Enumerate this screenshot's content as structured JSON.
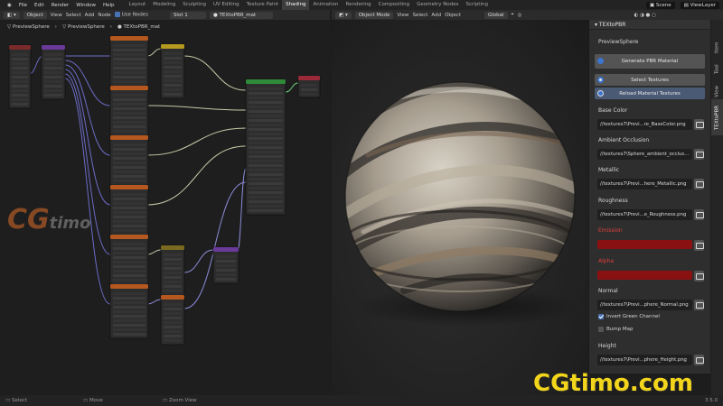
{
  "menubar": {
    "items": [
      "File",
      "Edit",
      "Render",
      "Window",
      "Help"
    ],
    "workspaces": [
      "Layout",
      "Modeling",
      "Sculpting",
      "UV Editing",
      "Texture Paint",
      "Shading",
      "Animation",
      "Rendering",
      "Compositing",
      "Geometry Nodes",
      "Scripting"
    ],
    "active_workspace": "Shading",
    "scene": "Scene",
    "view_layer": "ViewLayer"
  },
  "node_header": {
    "editor_type": "Object",
    "menus": [
      "View",
      "Select",
      "Add",
      "Node"
    ],
    "use_nodes_label": "Use Nodes",
    "slot": "Slot 1",
    "material": "TEXtoPBR_mat"
  },
  "breadcrumb": [
    "PreviewSphere",
    "PreviewSphere",
    "TEXtoPBR_mat"
  ],
  "viewport_header": {
    "mode": "Object Mode",
    "menus": [
      "View",
      "Select",
      "Add",
      "Object"
    ],
    "transform": "Global"
  },
  "panel": {
    "title": "TEXtoPBR",
    "object_name": "PreviewSphere",
    "generate_label": "Generate PBR Material",
    "select_label": "Select Textures",
    "reload_label": "Reload Material Textures",
    "base_color": {
      "label": "Base Color",
      "path": "//textures7\\Previ...re_BaseColor.png"
    },
    "ao": {
      "label": "Ambient Occlusion",
      "path": "//textures7\\Sphere_ambient_occlus..."
    },
    "metallic": {
      "label": "Metallic",
      "path": "//textures7\\Previ...here_Metallic.png"
    },
    "roughness": {
      "label": "Roughness",
      "path": "//textures7\\Previ...e_Roughness.png"
    },
    "emission": {
      "label": "Emission"
    },
    "alpha": {
      "label": "Alpha"
    },
    "normal": {
      "label": "Normal",
      "path": "//textures7\\Previ...phere_Normal.png"
    },
    "invert_green": {
      "label": "Invert Green Channel",
      "checked": true
    },
    "bump_map": {
      "label": "Bump Map",
      "checked": false
    },
    "height": {
      "label": "Height",
      "path": "//textures7\\Previ...phere_Height.png"
    },
    "swatch_color": "#8a1111"
  },
  "vtabs": [
    "Item",
    "Tool",
    "View",
    "TEXtoPBR"
  ],
  "statusbar": {
    "select": "Select",
    "move": "Move",
    "zoom": "Zoom View",
    "version": "3.5.0"
  },
  "watermark": {
    "site": "CGtimo.com",
    "logo_a": "CG",
    "logo_b": "timo"
  }
}
